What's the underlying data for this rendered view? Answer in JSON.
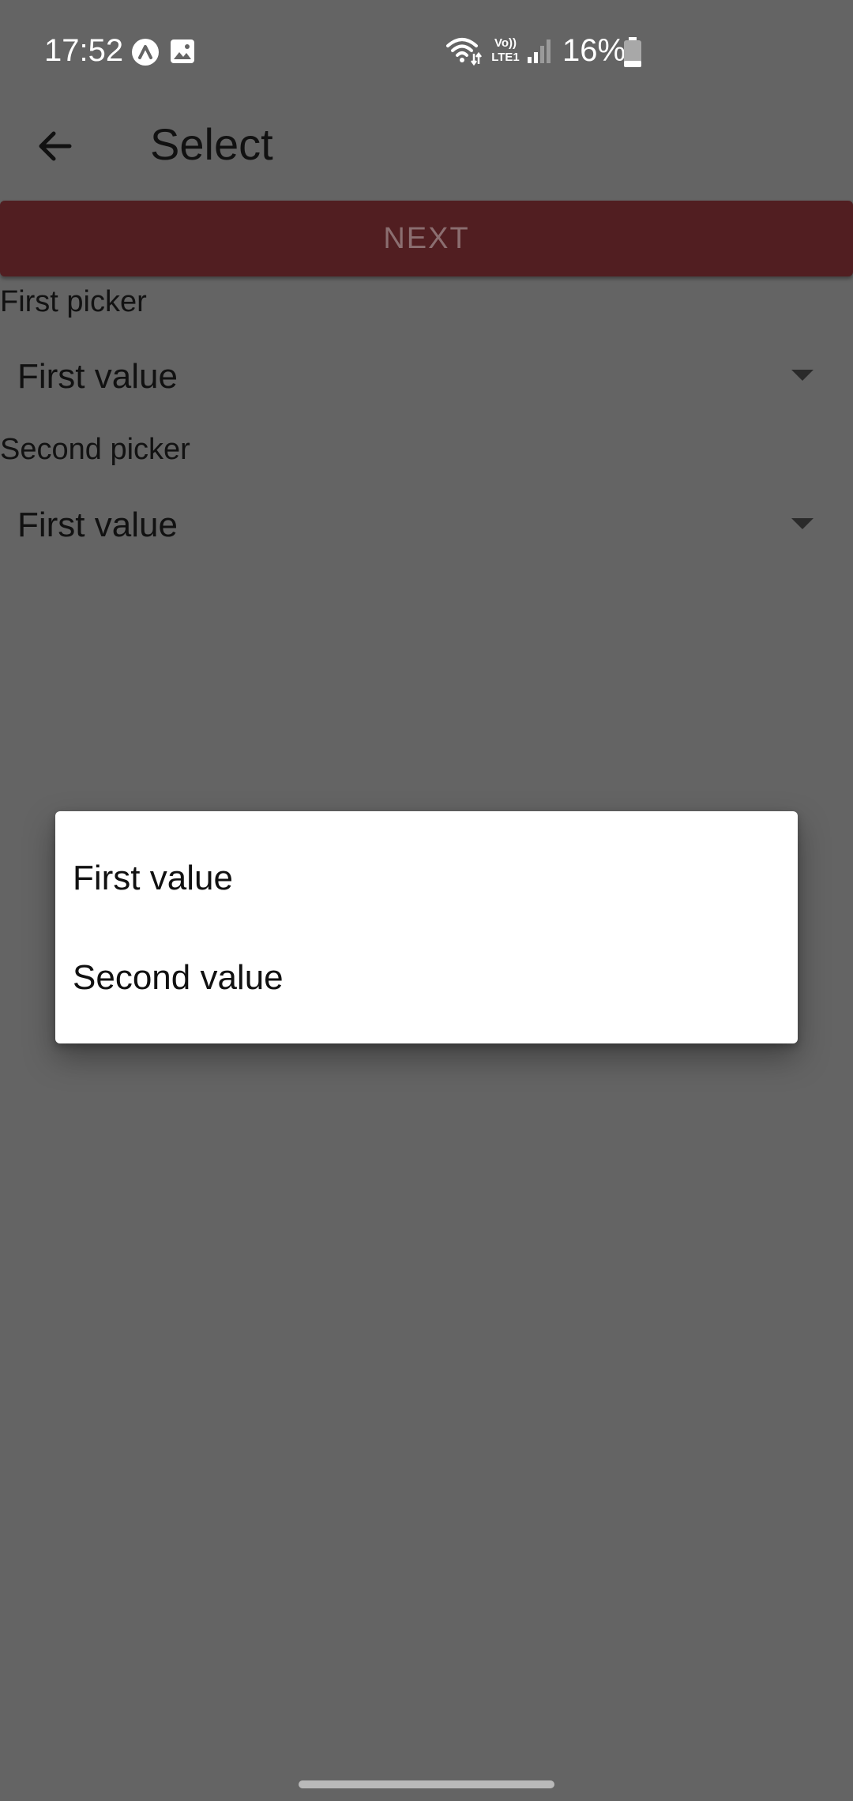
{
  "status_bar": {
    "time": "17:52",
    "battery_text": "16%",
    "icons": [
      "app-notification-icon",
      "image-notification-icon",
      "wifi-icon",
      "volte-icon",
      "signal-icon",
      "battery-icon"
    ],
    "volte_line1": "Vo))",
    "volte_line2": "LTE1"
  },
  "app_bar": {
    "back_icon": "arrow-left-icon",
    "title": "Select"
  },
  "next_button": {
    "label": "NEXT",
    "background": "#511e21"
  },
  "pickers": [
    {
      "label": "First picker",
      "value": "First value"
    },
    {
      "label": "Second picker",
      "value": "First value"
    }
  ],
  "dropdown": {
    "options": [
      "First value",
      "Second value"
    ]
  },
  "colors": {
    "scrim_background": "#646464",
    "dialog_background": "#ffffff"
  }
}
